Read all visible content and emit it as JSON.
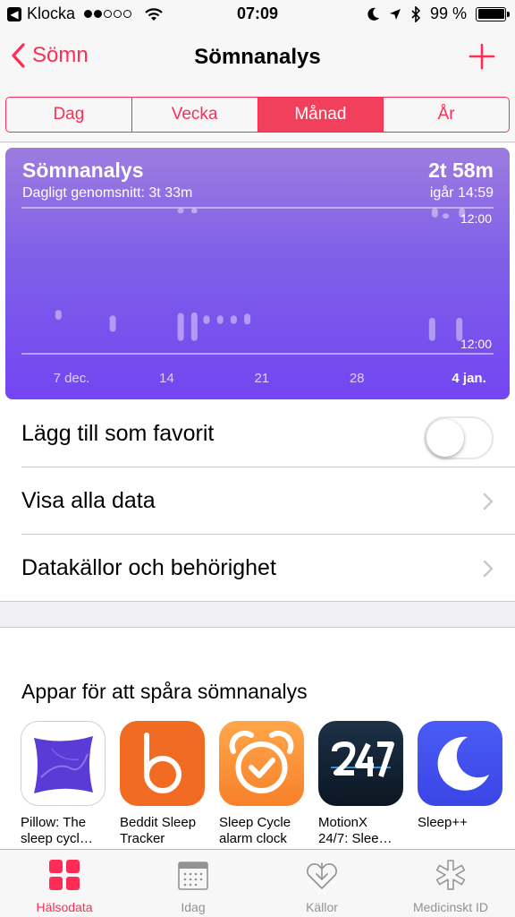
{
  "status_bar": {
    "back_app": "Klocka",
    "time": "07:09",
    "battery": "99 %"
  },
  "nav": {
    "back_label": "Sömn",
    "title": "Sömnanalys"
  },
  "segments": [
    {
      "label": "Dag",
      "active": false
    },
    {
      "label": "Vecka",
      "active": false
    },
    {
      "label": "Månad",
      "active": true
    },
    {
      "label": "År",
      "active": false
    }
  ],
  "chart": {
    "title": "Sömnanalys",
    "subtitle": "Dagligt genomsnitt: 3t 33m",
    "value": "2t 58m",
    "date": "igår 14:59",
    "colors": {
      "gradient_top": "#9d7ce0",
      "gradient_bottom": "#7346f2"
    }
  },
  "chart_data": {
    "type": "bar",
    "title": "Sömnanalys",
    "x_tick_labels": [
      "7 dec.",
      "14",
      "21",
      "28",
      "4 jan."
    ],
    "y_tick_labels": [
      "12:00",
      "12:00"
    ],
    "y_axis_note": "12:00 (top) to 12:00 (bottom), 24-hour span",
    "days": [
      "6 dec",
      "10 dec",
      "15 dec",
      "15 dec b",
      "16 dec",
      "16 dec b",
      "17 dec",
      "18 dec",
      "19 dec",
      "20 dec",
      "2 jan",
      "2 jan b",
      "3 jan",
      "4 jan",
      "4 jan b"
    ],
    "day_index": [
      -1,
      3,
      8,
      8,
      9,
      9,
      9.9,
      10.9,
      11.9,
      12.9,
      26.5,
      26.7,
      27.5,
      28.5,
      28.7
    ],
    "intervals_hours_from_top": [
      [
        16.8,
        18.4
      ],
      [
        17.7,
        20.4
      ],
      [
        17.3,
        21.9
      ],
      [
        0.05,
        0.75
      ],
      [
        17.2,
        21.9
      ],
      [
        0.05,
        0.75
      ],
      [
        17.7,
        19.1
      ],
      [
        17.7,
        19.1
      ],
      [
        17.7,
        19.1
      ],
      [
        17.4,
        19.2
      ],
      [
        18.1,
        21.9
      ],
      [
        0.05,
        1.6
      ],
      [
        0.9,
        1.5
      ],
      [
        18.1,
        21.9
      ],
      [
        0.05,
        1.6
      ]
    ]
  },
  "rows": {
    "favorite": "Lägg till som favorit",
    "show_all": "Visa alla data",
    "sources": "Datakällor och behörighet"
  },
  "apps": {
    "title": "Appar för att spåra sömnanalys",
    "items": [
      {
        "name": "Pillow: The\nsleep cycl…"
      },
      {
        "name": "Beddit Sleep\nTracker"
      },
      {
        "name": "Sleep Cycle\nalarm clock"
      },
      {
        "name": "MotionX\n24/7: Slee…"
      },
      {
        "name": "Sleep++"
      }
    ]
  },
  "tabs": [
    {
      "label": "Hälsodata",
      "active": true
    },
    {
      "label": "Idag",
      "active": false
    },
    {
      "label": "Källor",
      "active": false
    },
    {
      "label": "Medicinskt ID",
      "active": false
    }
  ],
  "colors": {
    "accent": "#ff2d55"
  }
}
